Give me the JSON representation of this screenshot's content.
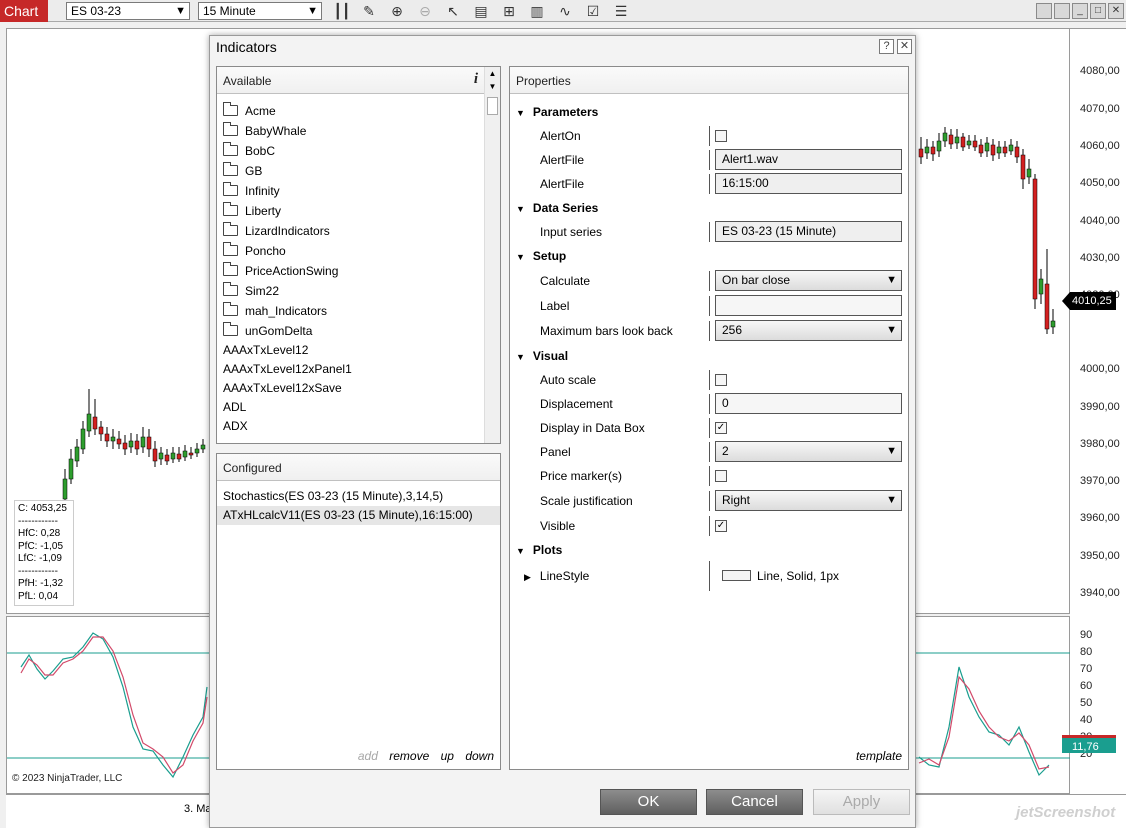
{
  "toolbar": {
    "tab_label": "Chart",
    "instrument": "ES 03-23",
    "interval": "15 Minute"
  },
  "chart": {
    "price_ticks": [
      "4080,00",
      "4070,00",
      "4060,00",
      "4050,00",
      "4040,00",
      "4030,00",
      "4020,00",
      "4010,25",
      "4000,00",
      "3990,00",
      "3980,00",
      "3970,00",
      "3960,00",
      "3950,00",
      "3940,00"
    ],
    "price_tag": "4010,25",
    "osc_ticks": [
      "90",
      "80",
      "70",
      "60",
      "50",
      "40",
      "30",
      "20"
    ],
    "osc_tag": "11,76",
    "time_label": "3. Ma",
    "copyright": "© 2023 NinjaTrader, LLC",
    "watermark": "jetScreenshot",
    "databox": {
      "close": "C: 4053,25",
      "sep": "------------",
      "hfc": "HfC: 0,28",
      "pfc": "PfC: -1,05",
      "lfc": "LfC: -1,09",
      "sep2": "------------",
      "pfh": "PfH: -1,32",
      "pfl": "PfL: 0,04"
    }
  },
  "dialog": {
    "title": "Indicators",
    "help_label": "?",
    "available_title": "Available",
    "folders": [
      "Acme",
      "BabyWhale",
      "BobC",
      "GB",
      "Infinity",
      "Liberty",
      "LizardIndicators",
      "Poncho",
      "PriceActionSwing",
      "Sim22",
      "mah_Indicators",
      "unGomDelta"
    ],
    "indicators": [
      "AAAxTxLevel12",
      "AAAxTxLevel12xPanel1",
      "AAAxTxLevel12xSave",
      "ADL",
      "ADX"
    ],
    "configured_title": "Configured",
    "configured": [
      "Stochastics(ES 03-23 (15 Minute),3,14,5)",
      "ATxHLcalcV11(ES 03-23 (15 Minute),16:15:00)"
    ],
    "actions": {
      "add": "add",
      "remove": "remove",
      "up": "up",
      "down": "down"
    },
    "properties_title": "Properties",
    "categories": {
      "parameters": "Parameters",
      "data_series": "Data Series",
      "setup": "Setup",
      "visual": "Visual",
      "plots": "Plots"
    },
    "params": {
      "alerton_label": "AlertOn",
      "alertfile_label": "AlertFile",
      "alertfile_value": "Alert1.wav",
      "alertfile2_label": "AlertFile",
      "alertfile2_value": "16:15:00"
    },
    "data_series": {
      "input_label": "Input series",
      "input_value": "ES 03-23 (15 Minute)"
    },
    "setup": {
      "calculate_label": "Calculate",
      "calculate_value": "On bar close",
      "label_label": "Label",
      "label_value": "",
      "maxbars_label": "Maximum bars look back",
      "maxbars_value": "256"
    },
    "visual": {
      "autoscale_label": "Auto scale",
      "displacement_label": "Displacement",
      "displacement_value": "0",
      "databox_label": "Display in Data Box",
      "panel_label": "Panel",
      "panel_value": "2",
      "pricemarker_label": "Price marker(s)",
      "scalejust_label": "Scale justification",
      "scalejust_value": "Right",
      "visible_label": "Visible"
    },
    "plots": {
      "linestyle_label": "LineStyle",
      "linestyle_value": "Line, Solid, 1px"
    },
    "template_label": "template",
    "ok_label": "OK",
    "cancel_label": "Cancel",
    "apply_label": "Apply"
  },
  "colors": {
    "up_candle": "#2e9e2e",
    "down_candle": "#d32020",
    "stoch_k": "#1a9e8f",
    "stoch_d": "#d24a6a",
    "accent": "#c62828"
  }
}
